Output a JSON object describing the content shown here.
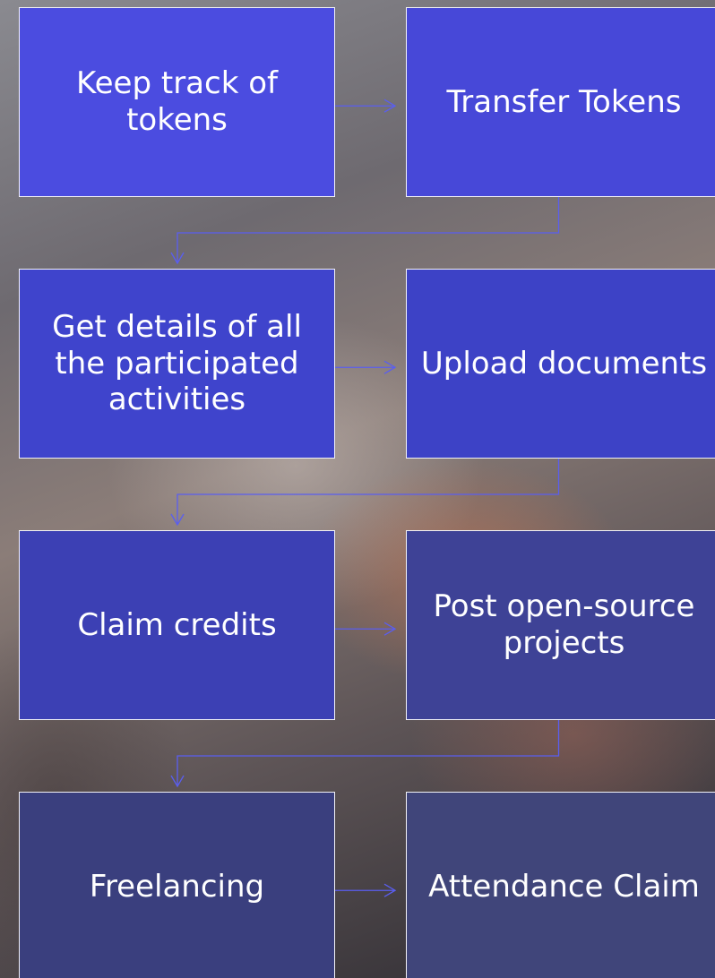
{
  "diagram": {
    "nodes": [
      {
        "id": "n1",
        "label": "Keep track of tokens",
        "fill": "#4b4ce0"
      },
      {
        "id": "n2",
        "label": "Transfer Tokens",
        "fill": "#4748d8"
      },
      {
        "id": "n3",
        "label": "Get details of all the participated activities",
        "fill": "#3f44cc"
      },
      {
        "id": "n4",
        "label": "Upload documents",
        "fill": "#3d42c6"
      },
      {
        "id": "n5",
        "label": "Claim credits",
        "fill": "#3c40b4"
      },
      {
        "id": "n6",
        "label": "Post open-source projects",
        "fill": "#3e4296"
      },
      {
        "id": "n7",
        "label": "Freelancing",
        "fill": "#3a3f7e"
      },
      {
        "id": "n8",
        "label": "Attendance Claim",
        "fill": "#40457a"
      }
    ],
    "edges": [
      {
        "from": "n1",
        "to": "n2"
      },
      {
        "from": "n2",
        "to": "n3"
      },
      {
        "from": "n3",
        "to": "n4"
      },
      {
        "from": "n4",
        "to": "n5"
      },
      {
        "from": "n5",
        "to": "n6"
      },
      {
        "from": "n6",
        "to": "n7"
      },
      {
        "from": "n7",
        "to": "n8"
      }
    ],
    "connector_color": "#5a5ef0"
  }
}
